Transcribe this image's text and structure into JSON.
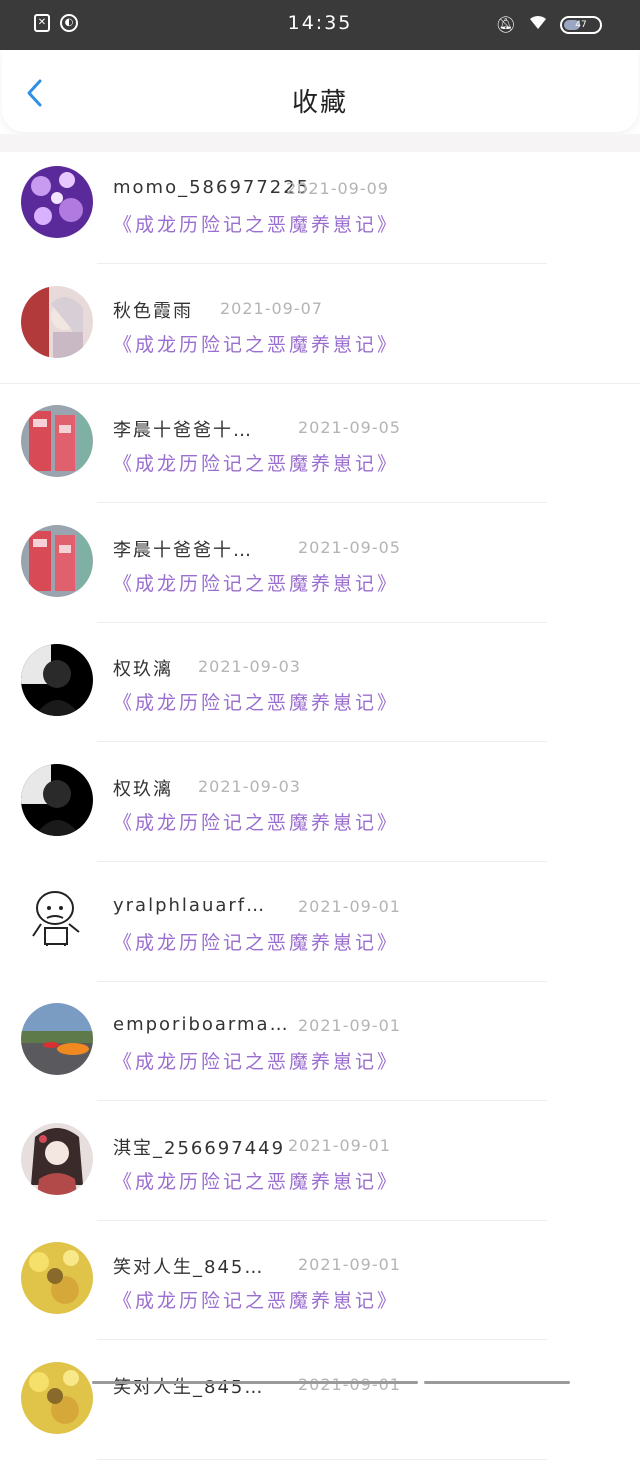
{
  "status": {
    "time": "14:35",
    "battery_text": "47",
    "battery_level": 0.47
  },
  "header": {
    "title": "收藏",
    "back_icon": "chevron-left-icon",
    "accent": "#2f8ee6"
  },
  "colors": {
    "book_title": "#9b6fcf",
    "date": "#b4b4b4",
    "name": "#333333"
  },
  "items": [
    {
      "name": "momo_586977225",
      "date": "2021-09-09",
      "book": "《成龙历险记之恶魔养崽记》",
      "avatar": "purple-flowers"
    },
    {
      "name": "秋色霞雨",
      "date": "2021-09-07",
      "book": "《成龙历险记之恶魔养崽记》",
      "avatar": "anime-girl-red"
    },
    {
      "name": "李晨十爸爸十…",
      "date": "2021-09-05",
      "book": "《成龙历险记之恶魔养崽记》",
      "avatar": "street-banners"
    },
    {
      "name": "李晨十爸爸十…",
      "date": "2021-09-05",
      "book": "《成龙历险记之恶魔养崽记》",
      "avatar": "street-banners"
    },
    {
      "name": "权玖漓",
      "date": "2021-09-03",
      "book": "《成龙历险记之恶魔养崽记》",
      "avatar": "dark-portrait"
    },
    {
      "name": "权玖漓",
      "date": "2021-09-03",
      "book": "《成龙历险记之恶魔养崽记》",
      "avatar": "dark-portrait"
    },
    {
      "name": "yralphlauarf…",
      "date": "2021-09-01",
      "book": "《成龙历险记之恶魔养崽记》",
      "avatar": "cartoon-baby"
    },
    {
      "name": "emporiboarma…",
      "date": "2021-09-01",
      "book": "《成龙历险记之恶魔养崽记》",
      "avatar": "sports-car"
    },
    {
      "name": "淇宝_256697449",
      "date": "2021-09-01",
      "book": "《成龙历险记之恶魔养崽记》",
      "avatar": "anime-girl-hanfu"
    },
    {
      "name": "笑对人生_845…",
      "date": "2021-09-01",
      "book": "《成龙历险记之恶魔养崽记》",
      "avatar": "yellow-flowers"
    },
    {
      "name": "笑对人生_845…",
      "date": "2021-09-01",
      "book": "",
      "avatar": "yellow-flowers"
    }
  ]
}
